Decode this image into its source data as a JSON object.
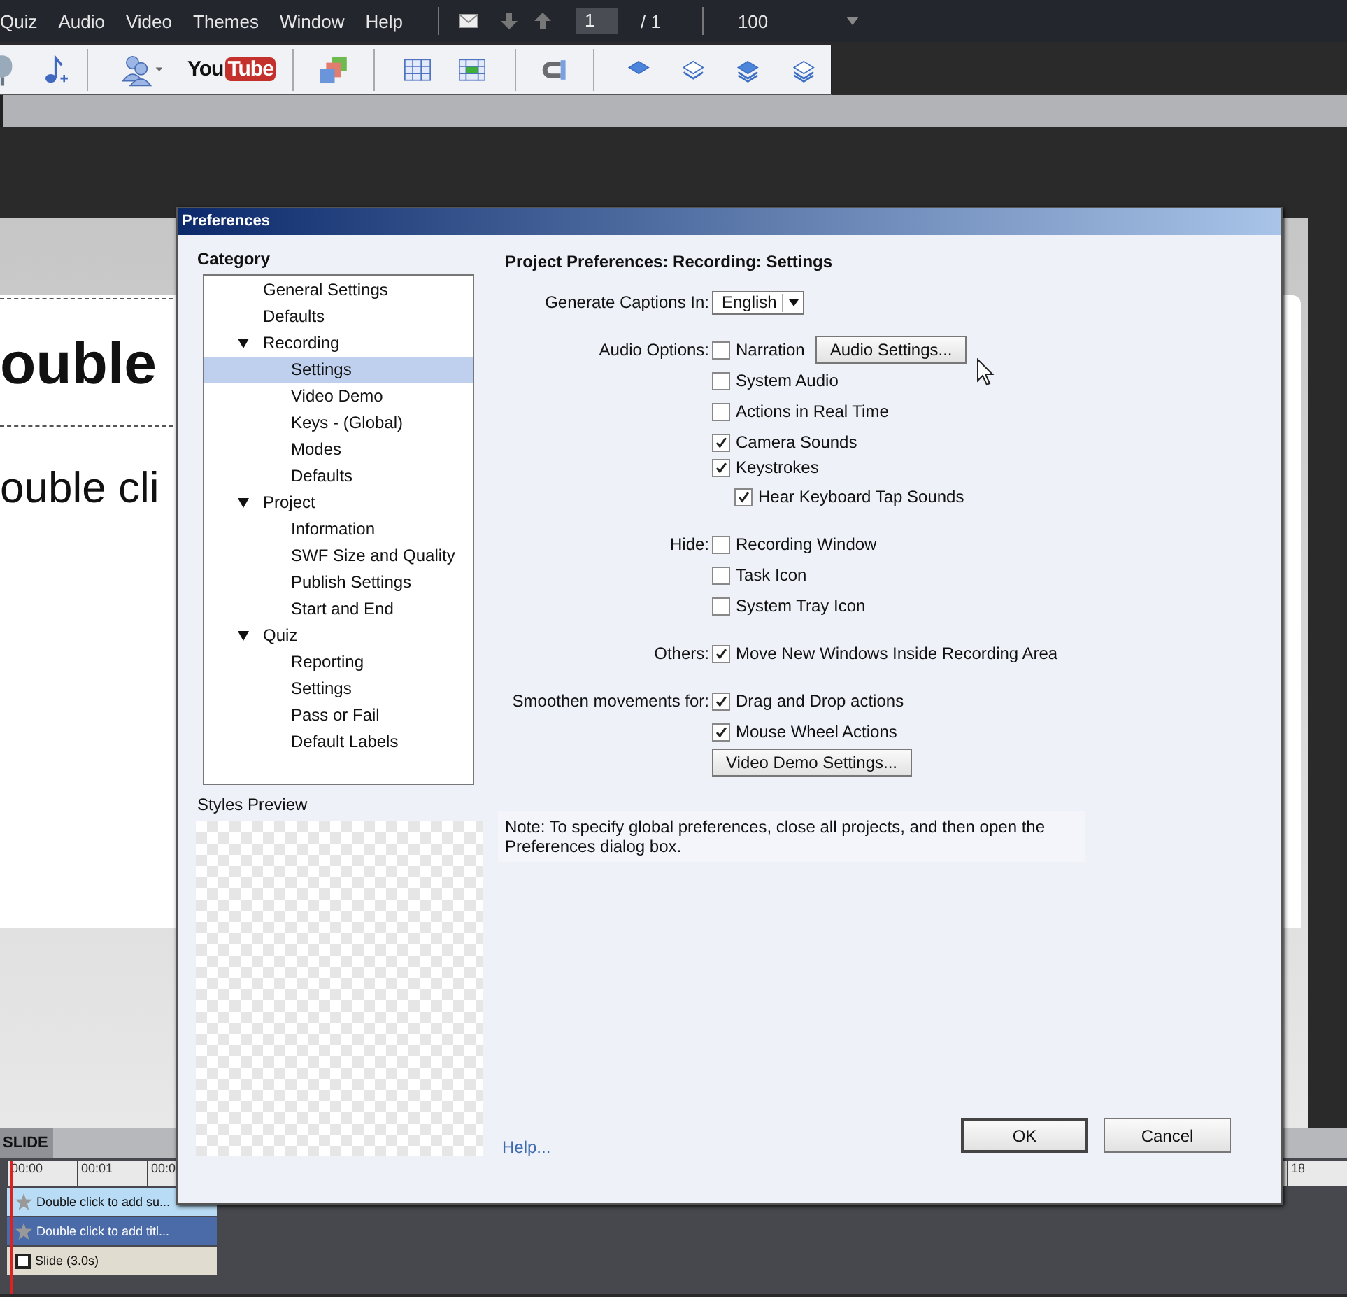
{
  "menu": {
    "items": [
      "Quiz",
      "Audio",
      "Video",
      "Themes",
      "Window",
      "Help"
    ],
    "page_field": "1",
    "page_total": "/ 1",
    "zoom": "100"
  },
  "toolbar": {
    "youtube_logo": [
      "You",
      "Tube"
    ]
  },
  "slide": {
    "title": "ouble",
    "subtitle": "ouble cli"
  },
  "timeline": {
    "tab": "SLIDE",
    "ruler_labels": [
      "00:00",
      "00:01",
      "00:0"
    ],
    "ruler_end_label": "18",
    "tracks": [
      {
        "label": "Double click to add su...",
        "kind": "caption"
      },
      {
        "label": "Double click to add titl...",
        "kind": "title"
      },
      {
        "label": "Slide (3.0s)",
        "kind": "slide"
      }
    ]
  },
  "dialog": {
    "title": "Preferences",
    "category_heading": "Category",
    "categories": [
      {
        "label": "General Settings",
        "selected": false
      },
      {
        "label": "Defaults",
        "selected": false
      },
      {
        "label": "Recording",
        "selected": false,
        "expanded": true,
        "children": [
          {
            "label": "Settings",
            "selected": true
          },
          {
            "label": "Video Demo",
            "selected": false
          },
          {
            "label": "Keys - (Global)",
            "selected": false
          },
          {
            "label": "Modes",
            "selected": false
          },
          {
            "label": "Defaults",
            "selected": false
          }
        ]
      },
      {
        "label": "Project",
        "selected": false,
        "expanded": true,
        "children": [
          {
            "label": "Information",
            "selected": false
          },
          {
            "label": "SWF Size and Quality",
            "selected": false
          },
          {
            "label": "Publish Settings",
            "selected": false
          },
          {
            "label": "Start and End",
            "selected": false
          }
        ]
      },
      {
        "label": "Quiz",
        "selected": false,
        "expanded": true,
        "children": [
          {
            "label": "Reporting",
            "selected": false
          },
          {
            "label": "Settings",
            "selected": false
          },
          {
            "label": "Pass or Fail",
            "selected": false
          },
          {
            "label": "Default Labels",
            "selected": false
          }
        ]
      }
    ],
    "styles_preview_label": "Styles Preview",
    "heading": "Project Preferences: Recording: Settings",
    "sections": [
      {
        "label": "Generate Captions In:",
        "rows": [
          [
            {
              "kind": "dropdown",
              "value": "English"
            }
          ]
        ]
      },
      {
        "label": "Audio Options:",
        "rows": [
          [
            {
              "kind": "checkbox",
              "label": "Narration",
              "checked": false
            },
            {
              "kind": "button",
              "label": "Audio Settings..."
            }
          ],
          [
            {
              "kind": "checkbox",
              "label": "System Audio",
              "checked": false
            }
          ],
          [
            {
              "kind": "checkbox",
              "label": "Actions in Real Time",
              "checked": false
            }
          ],
          [
            {
              "kind": "checkbox",
              "label": "Camera Sounds",
              "checked": true
            }
          ],
          [
            {
              "kind": "checkbox",
              "label": "Keystrokes",
              "checked": true,
              "children": [
                {
                  "kind": "checkbox",
                  "label": "Hear Keyboard Tap Sounds",
                  "checked": true
                }
              ]
            }
          ]
        ]
      },
      {
        "label": "Hide:",
        "rows": [
          [
            {
              "kind": "checkbox",
              "label": "Recording Window",
              "checked": false
            }
          ],
          [
            {
              "kind": "checkbox",
              "label": "Task Icon",
              "checked": false
            }
          ],
          [
            {
              "kind": "checkbox",
              "label": "System Tray Icon",
              "checked": false
            }
          ]
        ]
      },
      {
        "label": "Others:",
        "rows": [
          [
            {
              "kind": "checkbox",
              "label": "Move New Windows Inside Recording Area",
              "checked": true
            }
          ]
        ]
      },
      {
        "label": "Smoothen movements for:",
        "rows": [
          [
            {
              "kind": "checkbox",
              "label": "Drag and Drop actions",
              "checked": true
            }
          ],
          [
            {
              "kind": "checkbox",
              "label": "Mouse Wheel Actions",
              "checked": true
            }
          ],
          [
            {
              "kind": "button",
              "label": "Video Demo Settings..."
            }
          ]
        ]
      }
    ],
    "note": "Note: To specify global preferences, close all projects, and then open the Preferences dialog box.",
    "help_link": "Help...",
    "buttons": [
      {
        "label": "OK",
        "default": true
      },
      {
        "label": "Cancel",
        "default": false
      }
    ]
  }
}
